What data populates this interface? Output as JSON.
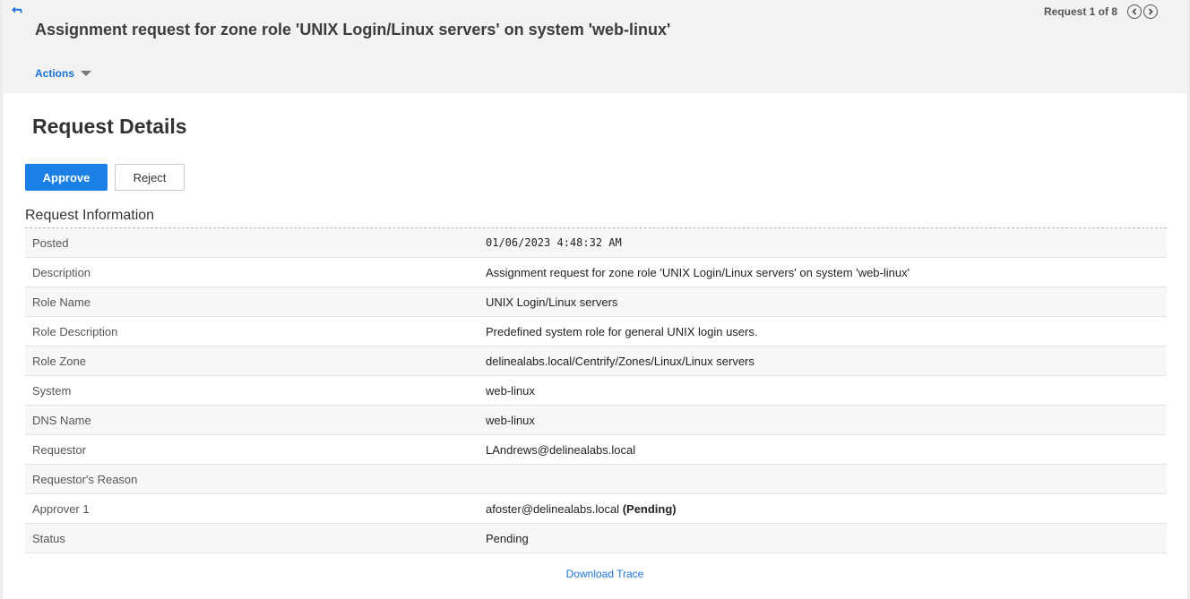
{
  "header": {
    "title": "Assignment request for zone role 'UNIX Login/Linux servers' on system 'web-linux'",
    "actions_label": "Actions",
    "pager_label": "Request 1 of 8"
  },
  "icons": {
    "back": "back-arrow-icon",
    "prev": "chevron-left-circle-icon",
    "next": "chevron-right-circle-icon",
    "actions_caret": "caret-down-icon"
  },
  "main": {
    "section_title": "Request Details",
    "approve_label": "Approve",
    "reject_label": "Reject",
    "info_title": "Request Information",
    "rows": [
      {
        "label": "Posted",
        "value": "01/06/2023 4:48:32 AM",
        "value_extra": ""
      },
      {
        "label": "Description",
        "value": "Assignment request for zone role 'UNIX Login/Linux servers' on system 'web-linux'",
        "value_extra": ""
      },
      {
        "label": "Role Name",
        "value": "UNIX Login/Linux servers",
        "value_extra": ""
      },
      {
        "label": "Role Description",
        "value": "Predefined system role for general UNIX login users.",
        "value_extra": ""
      },
      {
        "label": "Role Zone",
        "value": "delinealabs.local/Centrify/Zones/Linux/Linux servers",
        "value_extra": ""
      },
      {
        "label": "System",
        "value": "web-linux",
        "value_extra": ""
      },
      {
        "label": "DNS Name",
        "value": "web-linux",
        "value_extra": ""
      },
      {
        "label": "Requestor",
        "value": "LAndrews@delinealabs.local",
        "value_extra": ""
      },
      {
        "label": "Requestor's Reason",
        "value": "",
        "value_extra": ""
      },
      {
        "label": "Approver 1",
        "value": "afoster@delinealabs.local",
        "value_extra": "(Pending)"
      },
      {
        "label": "Status",
        "value": "Pending",
        "value_extra": ""
      }
    ],
    "download_label": "Download Trace"
  },
  "colors": {
    "accent": "#1a80e6",
    "link": "#1a73d9",
    "header_bg": "#f2f2f2"
  }
}
